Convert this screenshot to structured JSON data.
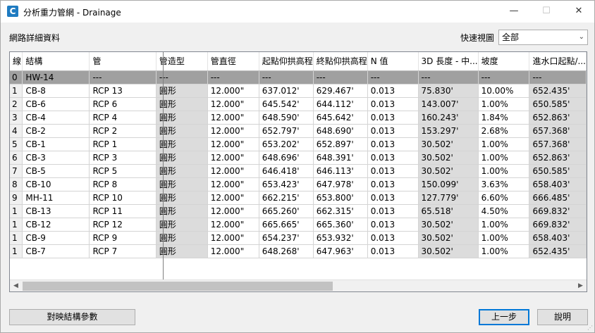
{
  "window": {
    "title": "分析重力管網 - Drainage",
    "app_icon_letter": "C",
    "minimize_glyph": "—",
    "maximize_glyph": "☐",
    "close_glyph": "✕"
  },
  "section_label": "網路詳細資料",
  "quick_view": {
    "label": "快速視圖",
    "value": "全部"
  },
  "table": {
    "columns": [
      "線",
      "結構",
      "管",
      "管造型",
      "管直徑",
      "起點仰拱高程",
      "終點仰拱高程",
      "N 值",
      "3D 長度 - 中...",
      "坡度",
      "進水口起點/..."
    ],
    "rows": [
      [
        "0",
        "HW-14",
        "---",
        "---",
        "---",
        "---",
        "---",
        "---",
        "---",
        "---",
        "---"
      ],
      [
        "1",
        "CB-8",
        "RCP 13",
        "圓形",
        "12.000\"",
        "637.012'",
        "629.467'",
        "0.013",
        "75.830'",
        "10.00%",
        "652.435'"
      ],
      [
        "2",
        "CB-6",
        "RCP 6",
        "圓形",
        "12.000\"",
        "645.542'",
        "644.112'",
        "0.013",
        "143.007'",
        "1.00%",
        "650.585'"
      ],
      [
        "3",
        "CB-4",
        "RCP 4",
        "圓形",
        "12.000\"",
        "648.590'",
        "645.642'",
        "0.013",
        "160.243'",
        "1.84%",
        "652.863'"
      ],
      [
        "4",
        "CB-2",
        "RCP 2",
        "圓形",
        "12.000\"",
        "652.797'",
        "648.690'",
        "0.013",
        "153.297'",
        "2.68%",
        "657.368'"
      ],
      [
        "5",
        "CB-1",
        "RCP 1",
        "圓形",
        "12.000\"",
        "653.202'",
        "652.897'",
        "0.013",
        "30.502'",
        "1.00%",
        "657.368'"
      ],
      [
        "6",
        "CB-3",
        "RCP 3",
        "圓形",
        "12.000\"",
        "648.696'",
        "648.391'",
        "0.013",
        "30.502'",
        "1.00%",
        "652.863'"
      ],
      [
        "7",
        "CB-5",
        "RCP 5",
        "圓形",
        "12.000\"",
        "646.418'",
        "646.113'",
        "0.013",
        "30.502'",
        "1.00%",
        "650.585'"
      ],
      [
        "8",
        "CB-10",
        "RCP 8",
        "圓形",
        "12.000\"",
        "653.423'",
        "647.978'",
        "0.013",
        "150.099'",
        "3.63%",
        "658.403'"
      ],
      [
        "9",
        "MH-11",
        "RCP 10",
        "圓形",
        "12.000\"",
        "662.215'",
        "653.800'",
        "0.013",
        "127.779'",
        "6.60%",
        "666.485'"
      ],
      [
        "1",
        "CB-13",
        "RCP 11",
        "圓形",
        "12.000\"",
        "665.260'",
        "662.315'",
        "0.013",
        "65.518'",
        "4.50%",
        "669.832'"
      ],
      [
        "1",
        "CB-12",
        "RCP 12",
        "圓形",
        "12.000\"",
        "665.665'",
        "665.360'",
        "0.013",
        "30.502'",
        "1.00%",
        "669.832'"
      ],
      [
        "1",
        "CB-9",
        "RCP 9",
        "圓形",
        "12.000\"",
        "654.237'",
        "653.932'",
        "0.013",
        "30.502'",
        "1.00%",
        "658.403'"
      ],
      [
        "1",
        "CB-7",
        "RCP 7",
        "圓形",
        "12.000\"",
        "648.268'",
        "647.963'",
        "0.013",
        "30.502'",
        "1.00%",
        "652.435'"
      ]
    ],
    "gray_columns": [
      3,
      8,
      10
    ]
  },
  "buttons": {
    "map_structure": "對映結構參數",
    "back": "上一步",
    "help": "說明"
  }
}
